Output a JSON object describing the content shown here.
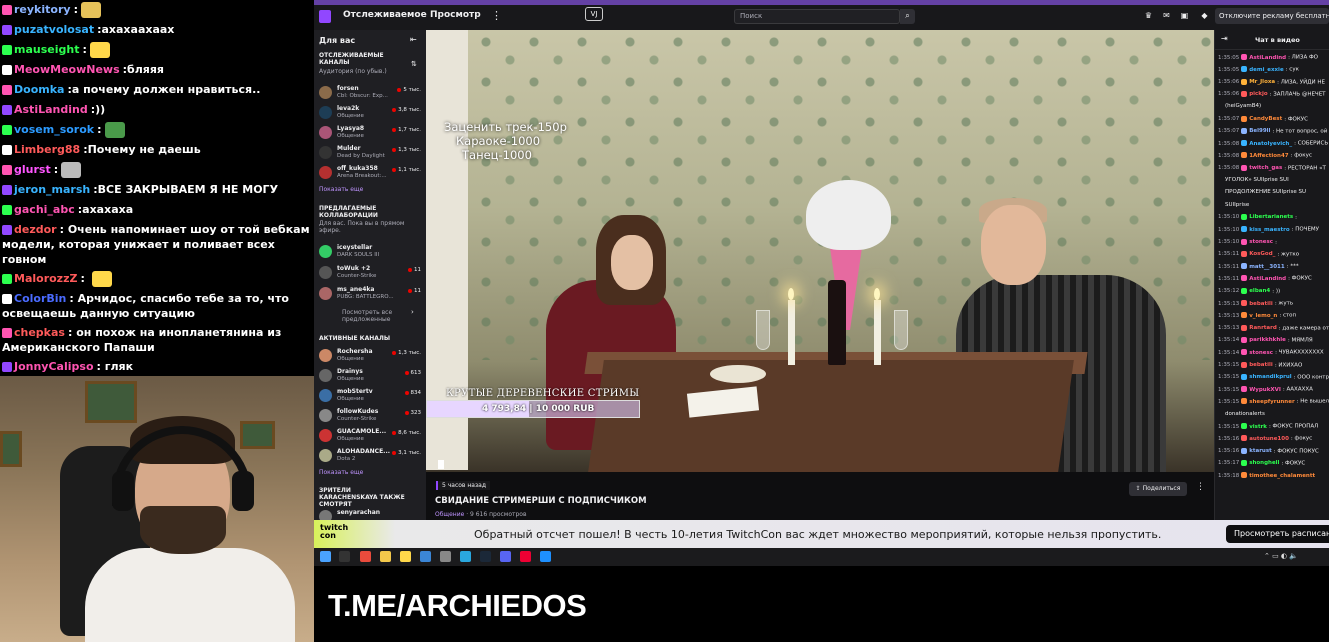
{
  "overlay_chat": [
    {
      "name": "reykitory",
      "color": "#8bb4ff",
      "text": "",
      "emote": "#e6c25a"
    },
    {
      "name": "puzatvolosat",
      "color": "#39b4ff",
      "text": "ахахаахаах",
      "emote": ""
    },
    {
      "name": "mauseight",
      "color": "#2cff4f",
      "text": "",
      "emote": "#ffd84a"
    },
    {
      "name": "MeowMeowNews",
      "color": "#ff55b2",
      "text": "бляяя",
      "emote": ""
    },
    {
      "name": "Doomka",
      "color": "#39b4ff",
      "text": "а почему должен нравиться..",
      "emote": ""
    },
    {
      "name": "AstiLandind",
      "color": "#ff55b2",
      "text": "))",
      "emote": ""
    },
    {
      "name": "vosem_sorok",
      "color": "#2c9bff",
      "text": "",
      "emote": "#4a9a4a"
    },
    {
      "name": "Limberg88",
      "color": "#ff5a5a",
      "text": "Почему не даешь",
      "emote": ""
    },
    {
      "name": "glurst",
      "color": "#ff55ff",
      "text": "",
      "emote": "#bbbbbb"
    },
    {
      "name": "jeron_marsh",
      "color": "#39b4ff",
      "text": "ВСЕ ЗАКРЫВАЕМ Я НЕ МОГУ",
      "emote": ""
    },
    {
      "name": "gachi_abc",
      "color": "#ff55b2",
      "text": "ахахаха",
      "emote": ""
    }
  ],
  "overlay_chat_wrapped": [
    {
      "name": "dezdor",
      "color": "#ff5a5a",
      "text": "Очень напоминает шоу от той вебкам модели, которая унижает и поливает всех говном"
    },
    {
      "name": "MalorozzZ",
      "color": "#ff5a5a",
      "text": ""
    },
    {
      "name": "ColorBin",
      "color": "#4a6bff",
      "text": "Арчидос, спасибо тебе за то, что освещаешь данную ситуацию"
    },
    {
      "name": "chepkas",
      "color": "#ff5a5a",
      "text": "он похож на инопланетянина из Американского Папаши"
    },
    {
      "name": "JonnyCalipso",
      "color": "#ff55b2",
      "text": "гляк"
    }
  ],
  "topbar": {
    "nav_following": "Отслеживаемое",
    "nav_browse": "Просмотр",
    "more": "⋮",
    "center_icon": "VJ",
    "search_placeholder": "Поиск",
    "search_icon": "⌕",
    "ad_button": "Отключите рекламу бесплатно"
  },
  "sidebar": {
    "header": "Для вас",
    "collapse": "⇤",
    "followed_title": "Отслеживаемые каналы",
    "followed_sub": "Аудитория (по убыв.)",
    "followed": [
      {
        "name": "forsen",
        "game": "Cbl: Obscur: Exp...",
        "viewers": "5 тыс.",
        "color": "#8b6b4a"
      },
      {
        "name": "leva2k",
        "game": "Общение",
        "viewers": "3,8 тыс.",
        "color": "#1d3d55"
      },
      {
        "name": "Lyasya8",
        "game": "Общение",
        "viewers": "1,7 тыс.",
        "color": "#aa5577"
      },
      {
        "name": "Mulder",
        "game": "Dead by Daylight",
        "viewers": "1,3 тыс.",
        "color": "#333"
      },
      {
        "name": "off_kuka358",
        "game": "Arena Breakout:...",
        "viewers": "1,1 тыс.",
        "color": "#b53030"
      }
    ],
    "show_more": "Показать еще",
    "collab_title": "Предлагаемые коллаборации",
    "collab_sub": "Для вас. Пока вы в прямом эфире.",
    "collabs": [
      {
        "name": "iceystellar",
        "game": "DARK SOULS III",
        "viewers": "",
        "color": "#3c6"
      },
      {
        "name": "toWuk +2",
        "game": "Counter-Strike",
        "viewers": "11",
        "color": "#555"
      },
      {
        "name": "ms_ane4ka",
        "game": "PUBG: BATTLEGRO...",
        "viewers": "11",
        "color": "#a66"
      }
    ],
    "collab_more": "Посмотреть все предложенные",
    "active_title": "Активные каналы",
    "active": [
      {
        "name": "Rochersha",
        "game": "Общение",
        "viewers": "1,3 тыс.",
        "color": "#cc8866"
      },
      {
        "name": "Drainys",
        "game": "Общение",
        "viewers": "613",
        "color": "#666"
      },
      {
        "name": "mobStertv",
        "game": "Общение",
        "viewers": "834",
        "color": "#3a6ea5"
      },
      {
        "name": "followKudes",
        "game": "Counter-Strike",
        "viewers": "323",
        "color": "#888"
      },
      {
        "name": "GUACAMOLE...",
        "game": "Общение",
        "viewers": "8,6 тыс.",
        "color": "#c33"
      },
      {
        "name": "ALOHADANCE...",
        "game": "Dota 2",
        "viewers": "3,1 тыс.",
        "color": "#aa8"
      }
    ],
    "active_more": "Показать еще",
    "viewers_also_title": "Зрители KARACHENSKAYA также смотрят",
    "viewers_also": [
      {
        "name": "senyarachan",
        "game": "",
        "viewers": "",
        "color": "#777"
      }
    ]
  },
  "video": {
    "overlay_lines": [
      "Заценить трек-150р",
      "Караоке-1000",
      "Танец-1000"
    ],
    "donation_title": "КРУТЫЕ ДЕРЕВЕНСКИЕ СТРИМЫ",
    "donation_amount": "4 793,84",
    "donation_goal": "10 000 RUB",
    "donation_progress": 0.479
  },
  "stream_info": {
    "ago": "5 часов назад",
    "title": "СВИДАНИЕ СТРИМЕРШИ С ПОДПИСЧИКОМ",
    "category": "Общение",
    "views": " · 9 616 просмотров",
    "share": "Поделиться",
    "more": "⋮"
  },
  "chat": {
    "title": "Чат в видео",
    "collapse": "⇥",
    "lines": [
      {
        "t": "1:35:05",
        "u": "AstiLandind",
        "c": "#ff55b2",
        "m": ": ЛИЗА ФО"
      },
      {
        "t": "1:35:05",
        "u": "demi_exxie",
        "c": "#39b4ff",
        "m": ": сук"
      },
      {
        "t": "1:35:06",
        "u": "Mr_Jloxa",
        "c": "#ffb23a",
        "m": ": ЛИЗА, УЙДИ НЕ"
      },
      {
        "t": "1:35:06",
        "u": "pickjo",
        "c": "#ff5a5a",
        "m": ": ЗАПЛАЧЬ @НЕЧЕТ"
      },
      {
        "t": "",
        "u": "",
        "c": "#efeff1",
        "m": "(heiGyamB4)"
      },
      {
        "t": "1:35:07",
        "u": "CandyBest",
        "c": "#ff8a3a",
        "m": ": ФОКУС"
      },
      {
        "t": "1:35:07",
        "u": "Bel99ll",
        "c": "#8bb4ff",
        "m": ": Не тот вопрос, ой не"
      },
      {
        "t": "1:35:08",
        "u": "Anatolyevich_",
        "c": "#39b4ff",
        "m": ": СОБЕРИСЬ"
      },
      {
        "t": "1:35:08",
        "u": "1Affection47",
        "c": "#ff8a3a",
        "m": ": фокус"
      },
      {
        "t": "1:35:08",
        "u": "twitch_gas",
        "c": "#ff55b2",
        "m": ": РЕСТОРАН «Т"
      },
      {
        "t": "",
        "u": "",
        "c": "#efeff1",
        "m": "УГОЛОК» SUIIprise SUI"
      },
      {
        "t": "",
        "u": "",
        "c": "#efeff1",
        "m": "ПРОДОЛЖЕНИЕ SUIIprise SU"
      },
      {
        "t": "",
        "u": "",
        "c": "#efeff1",
        "m": "SUIIprise"
      },
      {
        "t": "1:35:10",
        "u": "Libertarianets",
        "c": "#2cff4f",
        "m": ":"
      },
      {
        "t": "1:35:10",
        "u": "kiss_maestro",
        "c": "#39b4ff",
        "m": ": ПОЧЕМУ"
      },
      {
        "t": "1:35:10",
        "u": "stonesc",
        "c": "#ff55b2",
        "m": ":"
      },
      {
        "t": "1:35:11",
        "u": "KosGod_",
        "c": "#ff5a5a",
        "m": ": жутко"
      },
      {
        "t": "1:35:11",
        "u": "matt__3011",
        "c": "#8bb4ff",
        "m": ": ***"
      },
      {
        "t": "1:35:11",
        "u": "AstiLandind",
        "c": "#ff55b2",
        "m": ": ФОКУС"
      },
      {
        "t": "1:35:12",
        "u": "elban4",
        "c": "#2cff4f",
        "m": ": ))"
      },
      {
        "t": "1:35:13",
        "u": "bebatili",
        "c": "#ff5a5a",
        "m": ": жуть"
      },
      {
        "t": "1:35:13",
        "u": "v_lemo_n",
        "c": "#ff8a3a",
        "m": ": стоп"
      },
      {
        "t": "1:35:13",
        "u": "Ranrtard",
        "c": "#ff5a5a",
        "m": ": даже камера от"
      },
      {
        "t": "1:35:14",
        "u": "parikkhkhle",
        "c": "#ff55b2",
        "m": ": МЯМЛЯ"
      },
      {
        "t": "1:35:14",
        "u": "stonesc",
        "c": "#ff55b2",
        "m": ": ЧУВАКХХХХХХХ"
      },
      {
        "t": "1:35:15",
        "u": "bebatili",
        "c": "#ff5a5a",
        "m": ": ИХИХАО"
      },
      {
        "t": "1:35:15",
        "u": "shmandikprul",
        "c": "#39b4ff",
        "m": ": ООО контр"
      },
      {
        "t": "1:35:15",
        "u": "WypukXVI",
        "c": "#ff55b2",
        "m": ": ААХАХХА"
      },
      {
        "t": "1:35:15",
        "u": "sheepfyrunner",
        "c": "#ff8a3a",
        "m": ": Не вышел дл"
      },
      {
        "t": "",
        "u": "",
        "c": "#efeff1",
        "m": "donationalerts"
      },
      {
        "t": "1:35:15",
        "u": "vistrk",
        "c": "#2cff4f",
        "m": ": ФОКУС ПРОПАЛ"
      },
      {
        "t": "1:35:16",
        "u": "autotune100",
        "c": "#ff5a5a",
        "m": ": фокус"
      },
      {
        "t": "1:35:16",
        "u": "ktarust",
        "c": "#8bb4ff",
        "m": ": ФОКУС ПОКУС"
      },
      {
        "t": "1:35:17",
        "u": "shonghell",
        "c": "#2cff4f",
        "m": ": ФОКУС"
      },
      {
        "t": "1:35:18",
        "u": "timothee_chalamentt",
        "c": "#ff8a3a",
        "m": ""
      }
    ]
  },
  "banner": {
    "logo": "twitch con",
    "text": "Обратный отсчет пошел! В честь 10-летия TwitchCon вас ждет множество мероприятий, которые нельзя пропустить.",
    "button": "Просмотреть расписание"
  },
  "bottom": {
    "channel_text": "T.ME/ARCHIEDOS"
  }
}
